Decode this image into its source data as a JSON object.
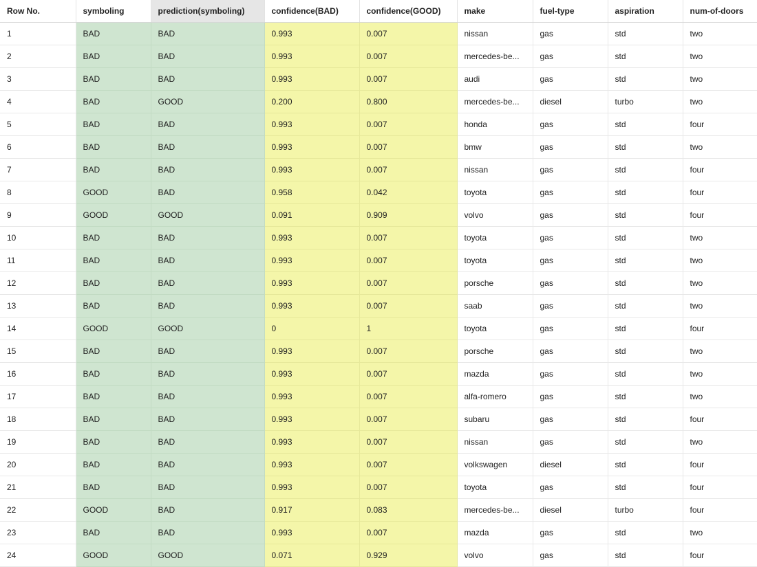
{
  "table": {
    "columns": [
      {
        "key": "row",
        "label": "Row No.",
        "highlight": "none",
        "sorted": false
      },
      {
        "key": "symboling",
        "label": "symboling",
        "highlight": "green",
        "sorted": false
      },
      {
        "key": "prediction",
        "label": "prediction(symboling)",
        "highlight": "green",
        "sorted": true
      },
      {
        "key": "conf_bad",
        "label": "confidence(BAD)",
        "highlight": "yellow",
        "sorted": false
      },
      {
        "key": "conf_good",
        "label": "confidence(GOOD)",
        "highlight": "yellow",
        "sorted": false
      },
      {
        "key": "make",
        "label": "make",
        "highlight": "none",
        "sorted": false
      },
      {
        "key": "fuel_type",
        "label": "fuel-type",
        "highlight": "none",
        "sorted": false
      },
      {
        "key": "aspiration",
        "label": "aspiration",
        "highlight": "none",
        "sorted": false
      },
      {
        "key": "num_of_doors",
        "label": "num-of-doors",
        "highlight": "none",
        "sorted": false
      }
    ],
    "rows": [
      [
        "1",
        "BAD",
        "BAD",
        "0.993",
        "0.007",
        "nissan",
        "gas",
        "std",
        "two"
      ],
      [
        "2",
        "BAD",
        "BAD",
        "0.993",
        "0.007",
        "mercedes-be...",
        "gas",
        "std",
        "two"
      ],
      [
        "3",
        "BAD",
        "BAD",
        "0.993",
        "0.007",
        "audi",
        "gas",
        "std",
        "two"
      ],
      [
        "4",
        "BAD",
        "GOOD",
        "0.200",
        "0.800",
        "mercedes-be...",
        "diesel",
        "turbo",
        "two"
      ],
      [
        "5",
        "BAD",
        "BAD",
        "0.993",
        "0.007",
        "honda",
        "gas",
        "std",
        "four"
      ],
      [
        "6",
        "BAD",
        "BAD",
        "0.993",
        "0.007",
        "bmw",
        "gas",
        "std",
        "two"
      ],
      [
        "7",
        "BAD",
        "BAD",
        "0.993",
        "0.007",
        "nissan",
        "gas",
        "std",
        "four"
      ],
      [
        "8",
        "GOOD",
        "BAD",
        "0.958",
        "0.042",
        "toyota",
        "gas",
        "std",
        "four"
      ],
      [
        "9",
        "GOOD",
        "GOOD",
        "0.091",
        "0.909",
        "volvo",
        "gas",
        "std",
        "four"
      ],
      [
        "10",
        "BAD",
        "BAD",
        "0.993",
        "0.007",
        "toyota",
        "gas",
        "std",
        "two"
      ],
      [
        "11",
        "BAD",
        "BAD",
        "0.993",
        "0.007",
        "toyota",
        "gas",
        "std",
        "two"
      ],
      [
        "12",
        "BAD",
        "BAD",
        "0.993",
        "0.007",
        "porsche",
        "gas",
        "std",
        "two"
      ],
      [
        "13",
        "BAD",
        "BAD",
        "0.993",
        "0.007",
        "saab",
        "gas",
        "std",
        "two"
      ],
      [
        "14",
        "GOOD",
        "GOOD",
        "0",
        "1",
        "toyota",
        "gas",
        "std",
        "four"
      ],
      [
        "15",
        "BAD",
        "BAD",
        "0.993",
        "0.007",
        "porsche",
        "gas",
        "std",
        "two"
      ],
      [
        "16",
        "BAD",
        "BAD",
        "0.993",
        "0.007",
        "mazda",
        "gas",
        "std",
        "two"
      ],
      [
        "17",
        "BAD",
        "BAD",
        "0.993",
        "0.007",
        "alfa-romero",
        "gas",
        "std",
        "two"
      ],
      [
        "18",
        "BAD",
        "BAD",
        "0.993",
        "0.007",
        "subaru",
        "gas",
        "std",
        "four"
      ],
      [
        "19",
        "BAD",
        "BAD",
        "0.993",
        "0.007",
        "nissan",
        "gas",
        "std",
        "two"
      ],
      [
        "20",
        "BAD",
        "BAD",
        "0.993",
        "0.007",
        "volkswagen",
        "diesel",
        "std",
        "four"
      ],
      [
        "21",
        "BAD",
        "BAD",
        "0.993",
        "0.007",
        "toyota",
        "gas",
        "std",
        "four"
      ],
      [
        "22",
        "GOOD",
        "BAD",
        "0.917",
        "0.083",
        "mercedes-be...",
        "diesel",
        "turbo",
        "four"
      ],
      [
        "23",
        "BAD",
        "BAD",
        "0.993",
        "0.007",
        "mazda",
        "gas",
        "std",
        "two"
      ],
      [
        "24",
        "GOOD",
        "GOOD",
        "0.071",
        "0.929",
        "volvo",
        "gas",
        "std",
        "four"
      ]
    ]
  },
  "colors": {
    "highlight_green": "#cfe5d0",
    "highlight_yellow": "#f4f6a9",
    "sorted_header": "#e6e6e6"
  }
}
